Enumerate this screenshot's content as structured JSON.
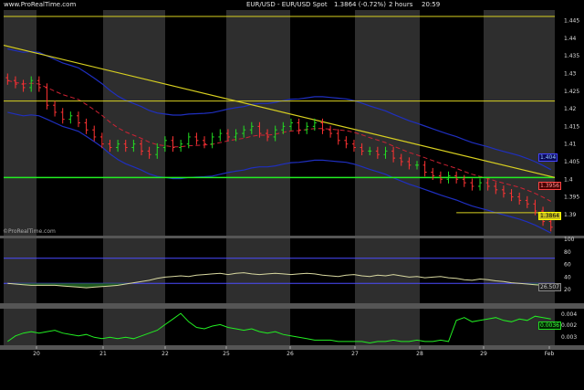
{
  "header": {
    "site": "www.ProRealTime.com",
    "symbol": "EUR/USD - EUR/USD Spot",
    "quote": "1.3864 (-0.72%)",
    "timeframe": "2 hours",
    "time": "20:59"
  },
  "watermark": "©ProRealTime.com",
  "colors": {
    "background": "#000000",
    "band_light": "#2e2e2e",
    "candle_up": "#22dd22",
    "candle_down": "#ff3333",
    "bollinger": "#1f2fbf",
    "moving_average": "#cc2233",
    "trendline": "#d8d020",
    "support": "#22ee22",
    "oscillator": "#d8d8a0",
    "sub_line": "#22ee22"
  },
  "chart_data": [
    {
      "type": "candlestick",
      "title": "EUR/USD - EUR/USD Spot",
      "x_tick_labels": [
        "20",
        "21",
        "22",
        "25",
        "26",
        "27",
        "28",
        "29",
        "Feb"
      ],
      "y_tick_labels": [
        "1.445",
        "1.44",
        "1.435",
        "1.43",
        "1.425",
        "1.42",
        "1.415",
        "1.41",
        "1.405",
        "1.4",
        "1.395",
        "1.39"
      ],
      "ylim": [
        1.384,
        1.448
      ],
      "grid": false,
      "closes": [
        1.428,
        1.427,
        1.426,
        1.428,
        1.426,
        1.421,
        1.419,
        1.417,
        1.418,
        1.416,
        1.414,
        1.412,
        1.41,
        1.409,
        1.41,
        1.409,
        1.41,
        1.408,
        1.407,
        1.409,
        1.411,
        1.409,
        1.41,
        1.412,
        1.411,
        1.41,
        1.412,
        1.413,
        1.412,
        1.413,
        1.414,
        1.415,
        1.413,
        1.412,
        1.414,
        1.415,
        1.416,
        1.414,
        1.415,
        1.416,
        1.414,
        1.413,
        1.411,
        1.41,
        1.409,
        1.408,
        1.408,
        1.407,
        1.408,
        1.406,
        1.405,
        1.404,
        1.404,
        1.402,
        1.401,
        1.4,
        1.401,
        1.4,
        1.399,
        1.398,
        1.399,
        1.398,
        1.397,
        1.396,
        1.395,
        1.394,
        1.393,
        1.391,
        1.388,
        1.3864
      ],
      "annotations": {
        "price_labels": [
          "1.404",
          "1.3956",
          "1.3864"
        ],
        "horizontal_levels": [
          1.4462,
          1.4222,
          1.4005,
          1.3905
        ],
        "trendline": {
          "from": [
            0,
            1.438
          ],
          "to": [
            69,
            1.4005
          ]
        }
      }
    },
    {
      "type": "line",
      "title": "",
      "y_tick_labels": [
        "100",
        "80",
        "60",
        "40",
        "20"
      ],
      "ylim": [
        0,
        100
      ],
      "levels": [
        70,
        30
      ],
      "last_value_label": "26.507",
      "values": [
        30,
        29,
        28,
        27,
        27,
        27,
        27,
        26,
        25,
        24,
        23,
        24,
        25,
        26,
        27,
        29,
        31,
        33,
        35,
        38,
        40,
        41,
        42,
        41,
        43,
        44,
        45,
        46,
        44,
        46,
        47,
        45,
        44,
        45,
        46,
        45,
        44,
        45,
        46,
        45,
        43,
        42,
        41,
        43,
        44,
        42,
        41,
        43,
        42,
        44,
        42,
        40,
        41,
        39,
        40,
        41,
        39,
        38,
        36,
        35,
        37,
        36,
        34,
        33,
        31,
        30,
        29,
        28,
        27,
        26.507
      ]
    },
    {
      "type": "line",
      "title": "",
      "y_tick_labels": [
        "0.004",
        "0.002",
        "0.003"
      ],
      "last_value_label": "0.0036",
      "values": [
        0.002,
        0.0024,
        0.0026,
        0.0027,
        0.0026,
        0.0027,
        0.0028,
        0.0026,
        0.0025,
        0.0024,
        0.0025,
        0.0023,
        0.0022,
        0.0023,
        0.0022,
        0.0023,
        0.0022,
        0.0024,
        0.0026,
        0.0028,
        0.0032,
        0.0036,
        0.004,
        0.0034,
        0.003,
        0.0029,
        0.0031,
        0.0032,
        0.003,
        0.0029,
        0.0028,
        0.0029,
        0.0027,
        0.0026,
        0.0027,
        0.0025,
        0.0024,
        0.0023,
        0.0022,
        0.0021,
        0.0021,
        0.0021,
        0.002,
        0.002,
        0.002,
        0.002,
        0.0019,
        0.002,
        0.002,
        0.0021,
        0.002,
        0.002,
        0.0021,
        0.002,
        0.002,
        0.0021,
        0.002,
        0.0035,
        0.0037,
        0.0034,
        0.0035,
        0.0036,
        0.0037,
        0.0035,
        0.0034,
        0.0036,
        0.0035,
        0.0038,
        0.0037,
        0.0036
      ]
    }
  ]
}
